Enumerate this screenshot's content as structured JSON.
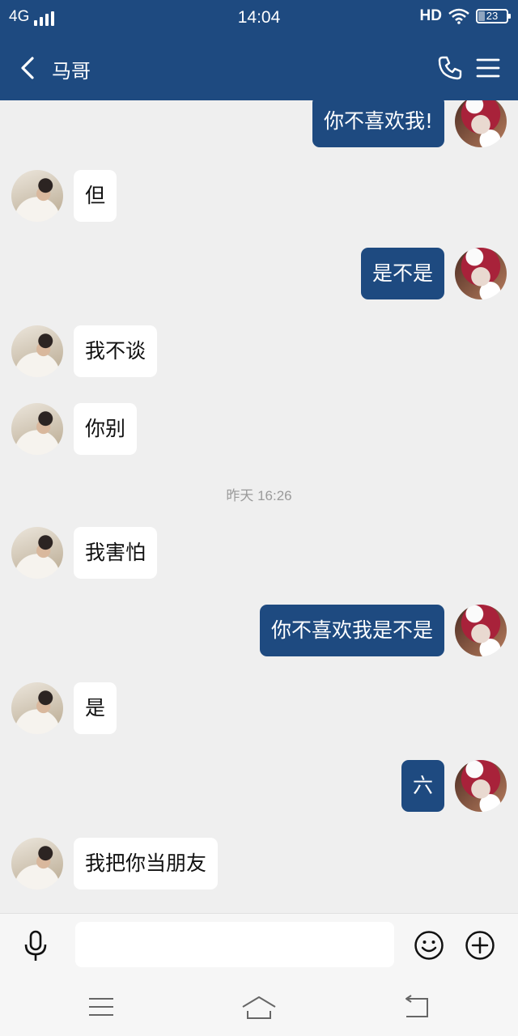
{
  "status_bar": {
    "network": "4G",
    "time": "14:04",
    "hd": "HD",
    "battery": "23"
  },
  "header": {
    "title": "马哥",
    "icons": [
      "back-icon",
      "phone-icon",
      "menu-icon"
    ]
  },
  "messages": [
    {
      "sender": "self",
      "text": "你不喜欢我!"
    },
    {
      "sender": "other",
      "text": "但"
    },
    {
      "sender": "self",
      "text": "是不是"
    },
    {
      "sender": "other",
      "text": "我不谈"
    },
    {
      "sender": "other",
      "text": "你别"
    },
    {
      "type": "timestamp",
      "text": "昨天 16:26"
    },
    {
      "sender": "other",
      "text": "我害怕"
    },
    {
      "sender": "self",
      "text": "你不喜欢我是不是"
    },
    {
      "sender": "other",
      "text": "是"
    },
    {
      "sender": "self",
      "text": "六"
    },
    {
      "sender": "other",
      "text": "我把你当朋友"
    }
  ],
  "input_bar": {
    "value": "",
    "icons": [
      "microphone-icon",
      "emoji-icon",
      "plus-icon"
    ]
  },
  "system_nav": {
    "icons": [
      "system-menu-icon",
      "system-home-icon",
      "system-back-icon"
    ]
  },
  "colors": {
    "header_bg": "#1e4a80",
    "self_bubble": "#1e4a80",
    "other_bubble": "#ffffff",
    "chat_bg": "#efefef"
  }
}
